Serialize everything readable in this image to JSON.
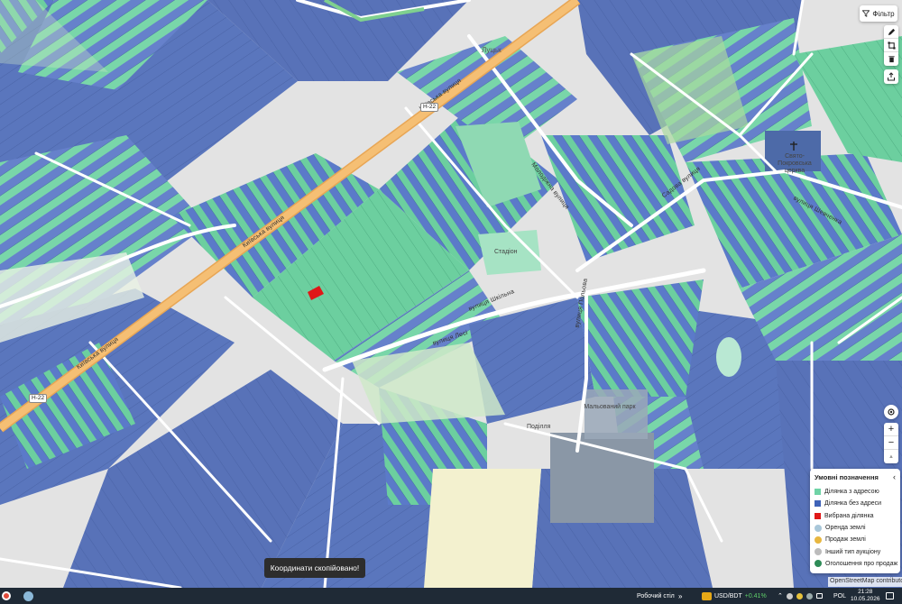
{
  "map": {
    "road_labels": [
      {
        "id": "kyivska-1",
        "text": "Київська вулиця"
      },
      {
        "id": "kyivska-2",
        "text": "Київська вулиця"
      },
      {
        "id": "kyivska-3",
        "text": "Київська вулиця"
      },
      {
        "id": "street-a",
        "text": "вулиця Лесі"
      },
      {
        "id": "street-b",
        "text": "вулиця Польова"
      },
      {
        "id": "street-c",
        "text": "Садова вулиця"
      },
      {
        "id": "street-d",
        "text": "вулиця Шкільна"
      },
      {
        "id": "street-e",
        "text": "вулиця Шевченка"
      },
      {
        "id": "street-f",
        "text": "Молодіжна вулиця"
      }
    ],
    "route_shields": [
      "H-22",
      "H-22"
    ],
    "place_labels": {
      "town": "Луцьк",
      "church": "Свято-Покровська церква",
      "stadium": "Стадіон",
      "pond": "Мальований парк",
      "industrial": "Поділля"
    },
    "selected_parcel_color": "#e01818",
    "colors": {
      "parcel_with_address": "#6fd3a6",
      "parcel_no_address": "#5b7ac9",
      "selected": "#e01818",
      "road_main": "#f1b05e",
      "road": "#ffffff"
    }
  },
  "toolbar": {
    "filter_label": "Фільтр",
    "filter_icon": "filter-icon",
    "tools": [
      "pencil-icon",
      "square-icon",
      "trash-icon"
    ],
    "export_icon": "export-icon",
    "zoom_in": "+",
    "zoom_out": "−",
    "north": "▲",
    "locate_icon": "locate-icon"
  },
  "legend": {
    "title": "Умовні позначення",
    "items": [
      {
        "label": "Ділянка з адресою",
        "kind": "square",
        "color": "#6fd3a6"
      },
      {
        "label": "Ділянка без адреси",
        "kind": "square",
        "color": "#3f63b8"
      },
      {
        "label": "Вибрана ділянка",
        "kind": "square",
        "color": "#e01818"
      },
      {
        "label": "Оренда землі",
        "kind": "dot",
        "color": "#a9c7d9"
      },
      {
        "label": "Продаж землі",
        "kind": "dot",
        "color": "#e8b740"
      },
      {
        "label": "Інший тип аукціону",
        "kind": "dot",
        "color": "#bcbcbc"
      },
      {
        "label": "Оголошення про продаж",
        "kind": "dot",
        "color": "#2e8b57"
      }
    ]
  },
  "attribution": "OpenStreetMap contributors",
  "toast": "Координати скопійовано!",
  "taskbar": {
    "desktop_label": "Робочий стіл",
    "ticker": "USD/BDT",
    "ticker_change": "+0.41%",
    "language": "POL",
    "time": "21:28",
    "date": "10.05.2026"
  }
}
